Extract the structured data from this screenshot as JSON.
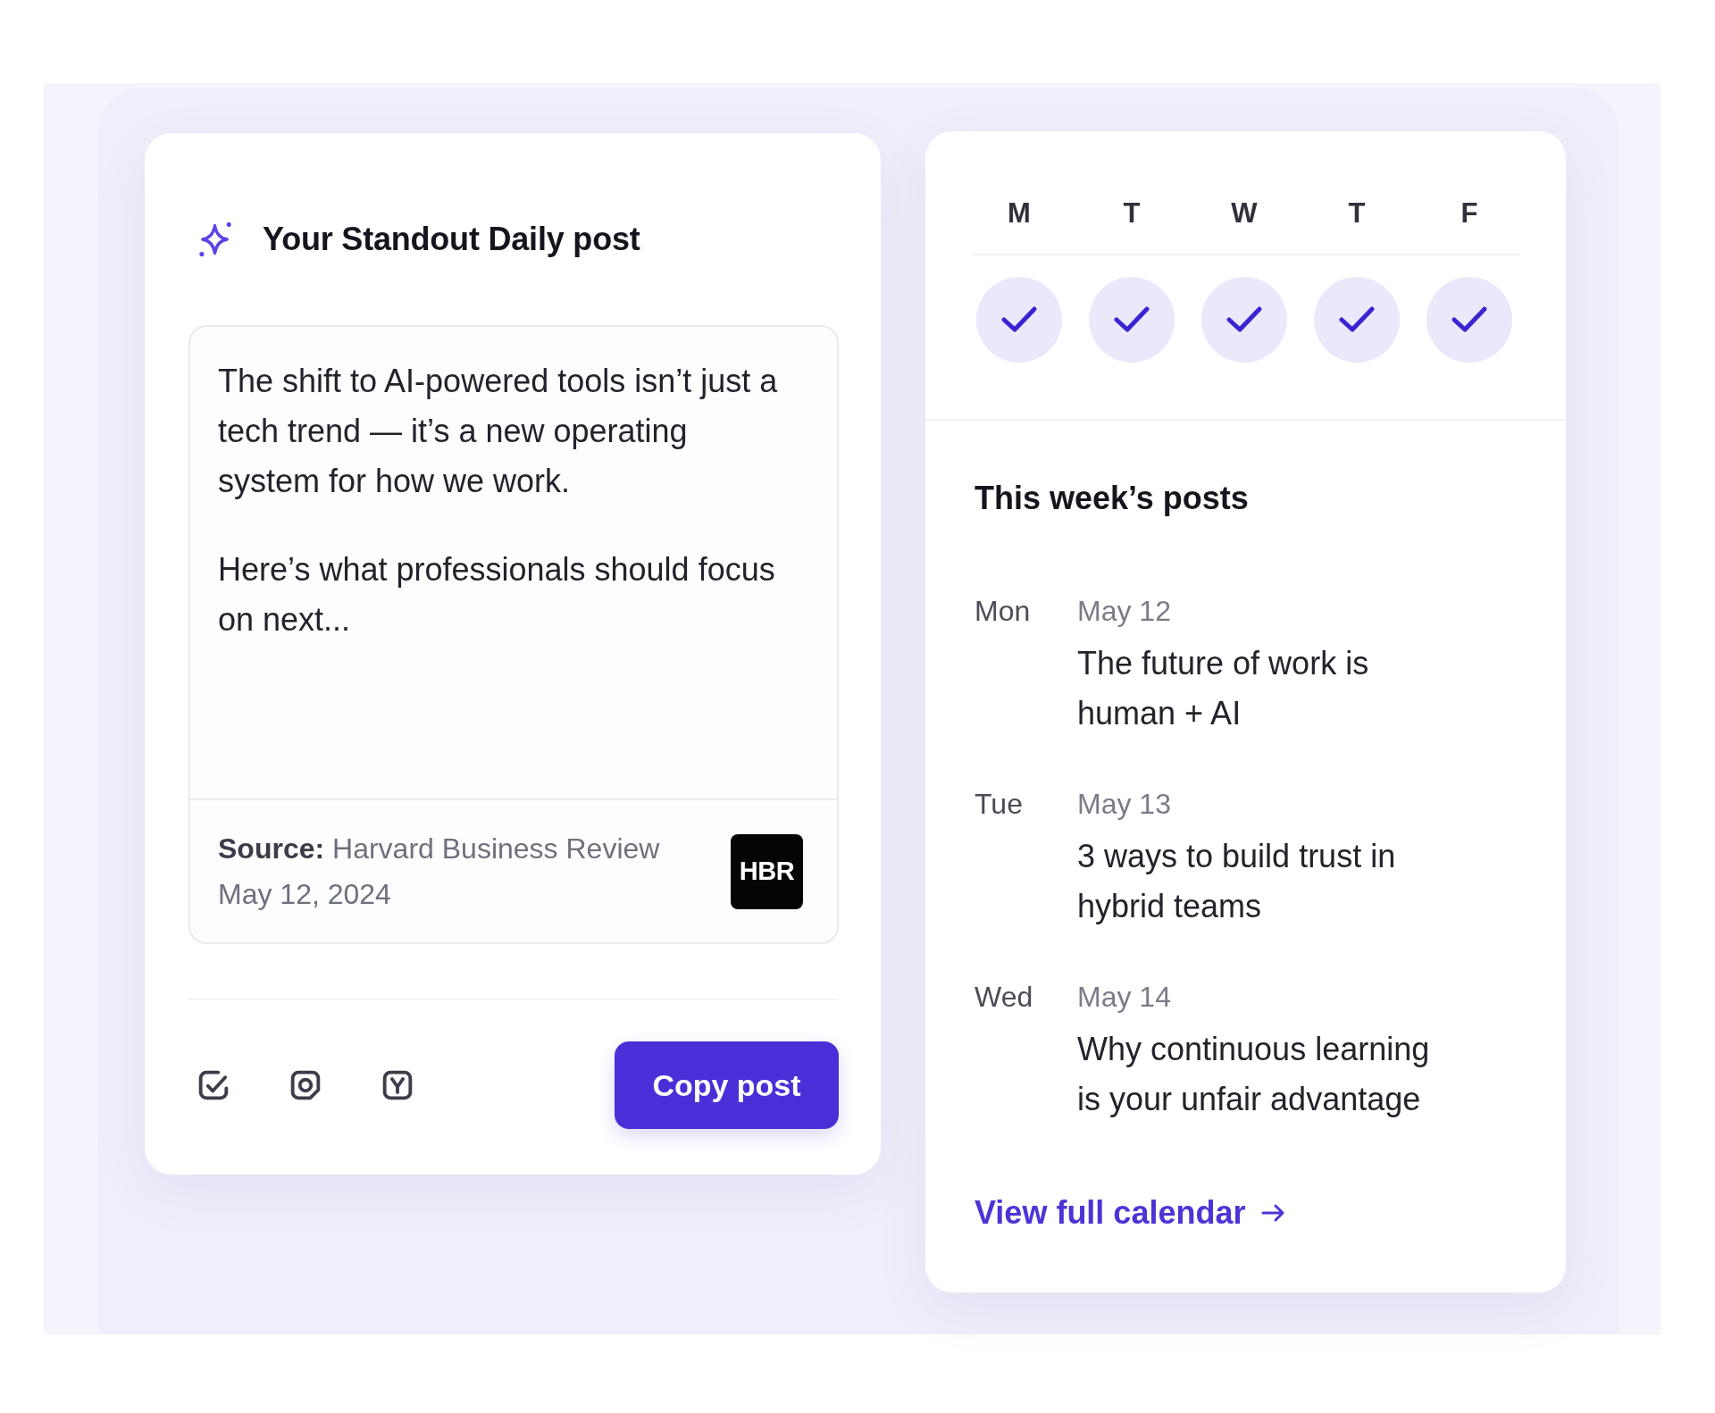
{
  "daily_post": {
    "title": "Your Standout Daily post",
    "paragraphs": [
      "The shift to AI-powered tools isn’t just a tech trend — it’s a new operating system for how we work.",
      "Here’s what professionals should focus on next..."
    ],
    "source": "**Source:** Harvard Business Review",
    "date": "May 12, 2024",
    "logo": "HBR",
    "copy_button": "Copy post"
  },
  "calendar": {
    "days": [
      {
        "label": "M",
        "checked": true
      },
      {
        "label": "T",
        "checked": true
      },
      {
        "label": "W",
        "checked": true
      },
      {
        "label": "T",
        "checked": true
      },
      {
        "label": "F",
        "checked": true
      }
    ]
  },
  "week_posts": {
    "title": "This week’s posts",
    "posts": [
      {
        "day": "Mon",
        "date": "May 12",
        "title": "The future of work is human + AI"
      },
      {
        "day": "Tue",
        "date": "May 13",
        "title": "3 ways to build trust in hybrid teams"
      },
      {
        "day": "Wed",
        "date": "May 14",
        "title": "Why continuous learning is your unfair advantage"
      }
    ]
  },
  "calendar_link": "View full calendar"
}
